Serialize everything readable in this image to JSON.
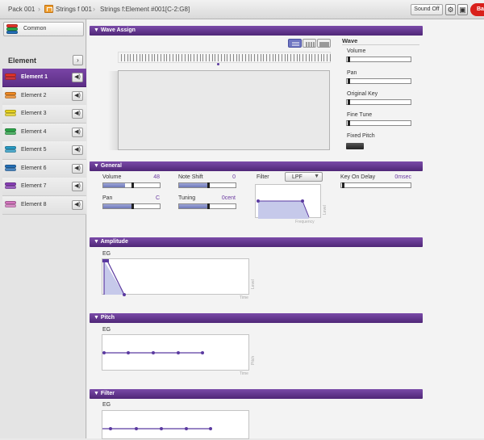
{
  "topbar": {
    "breadcrumb_pack": "Pack 001",
    "breadcrumb_voice": "Strings f 001",
    "breadcrumb_element": "Strings f:Element #001[C-2:G8]",
    "sound_off": "Sound Off",
    "back_label": "Back"
  },
  "sidebar": {
    "common_label": "Common",
    "element_title": "Element",
    "nav_icon": "›",
    "elements": [
      {
        "label": "Element 1",
        "color": "#e4352b"
      },
      {
        "label": "Element 2",
        "color": "#f08a24"
      },
      {
        "label": "Element 3",
        "color": "#e9d41f"
      },
      {
        "label": "Element 4",
        "color": "#2da84a"
      },
      {
        "label": "Element 5",
        "color": "#2a9ec8"
      },
      {
        "label": "Element 6",
        "color": "#2470b8"
      },
      {
        "label": "Element 7",
        "color": "#8a3fb8"
      },
      {
        "label": "Element 8",
        "color": "#d677c0"
      }
    ],
    "selected_index": 0
  },
  "wave_assign": {
    "title": "Wave Assign",
    "panel_title": "Wave",
    "volume_label": "Volume",
    "volume_value": 0.03,
    "pan_label": "Pan",
    "pan_value": 0.03,
    "original_key_label": "Original Key",
    "original_key_value": 0.03,
    "fine_tune_label": "Fine Tune",
    "fine_tune_value": 0.03,
    "fixed_pitch_label": "Fixed Pitch"
  },
  "general": {
    "title": "General",
    "volume_label": "Volume",
    "volume_value": "48",
    "volume_level": 0.38,
    "note_shift_label": "Note Shift",
    "note_shift_value": "0",
    "note_shift_level": 0.5,
    "pan_label": "Pan",
    "pan_value": "C",
    "pan_level": 0.5,
    "tuning_label": "Tuning",
    "tuning_value": "0cent",
    "tuning_level": 0.5,
    "filter_label": "Filter",
    "filter_type": "LPF",
    "filter_xlabel": "Frequency",
    "filter_ylabel": "Level",
    "key_on_delay_label": "Key On Delay",
    "key_on_delay_value": "0msec",
    "key_on_delay_level": 0.02
  },
  "amplitude": {
    "title": "Amplitude",
    "eg_label": "EG",
    "xlabel": "Time",
    "ylabel": "Level"
  },
  "pitch": {
    "title": "Pitch",
    "eg_label": "EG",
    "xlabel": "Time",
    "ylabel": "Pitch"
  },
  "filter": {
    "title": "Filter",
    "eg_label": "EG"
  },
  "colors": {
    "accent": "#5e2f8c",
    "slider_fill": "#8b93cc",
    "selected_row": "#6b3a98"
  }
}
